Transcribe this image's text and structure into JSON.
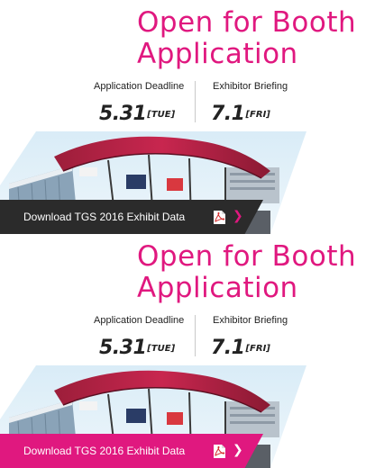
{
  "banners": [
    {
      "headline_line1": "Open for Booth",
      "headline_line2": "Application",
      "deadline_label": "Application Deadline",
      "deadline_date": "5.31",
      "deadline_dow": "[TUE]",
      "briefing_label": "Exhibitor Briefing",
      "briefing_date": "7.1",
      "briefing_dow": "[FRI]",
      "download_label": "Download TGS 2016 Exhibit Data",
      "download_bar_color": "#2b2b2b",
      "icons": [
        "pdf-icon",
        "chevron-right-icon"
      ]
    },
    {
      "headline_line1": "Open for Booth",
      "headline_line2": "Application",
      "deadline_label": "Application Deadline",
      "deadline_date": "5.31",
      "deadline_dow": "[TUE]",
      "briefing_label": "Exhibitor Briefing",
      "briefing_date": "7.1",
      "briefing_dow": "[FRI]",
      "download_label": "Download TGS 2016 Exhibit Data",
      "download_bar_color": "#e0187f",
      "icons": [
        "pdf-icon",
        "chevron-right-icon"
      ]
    }
  ],
  "colors": {
    "accent": "#e0187f",
    "dark_bar": "#2b2b2b",
    "text": "#222222"
  }
}
